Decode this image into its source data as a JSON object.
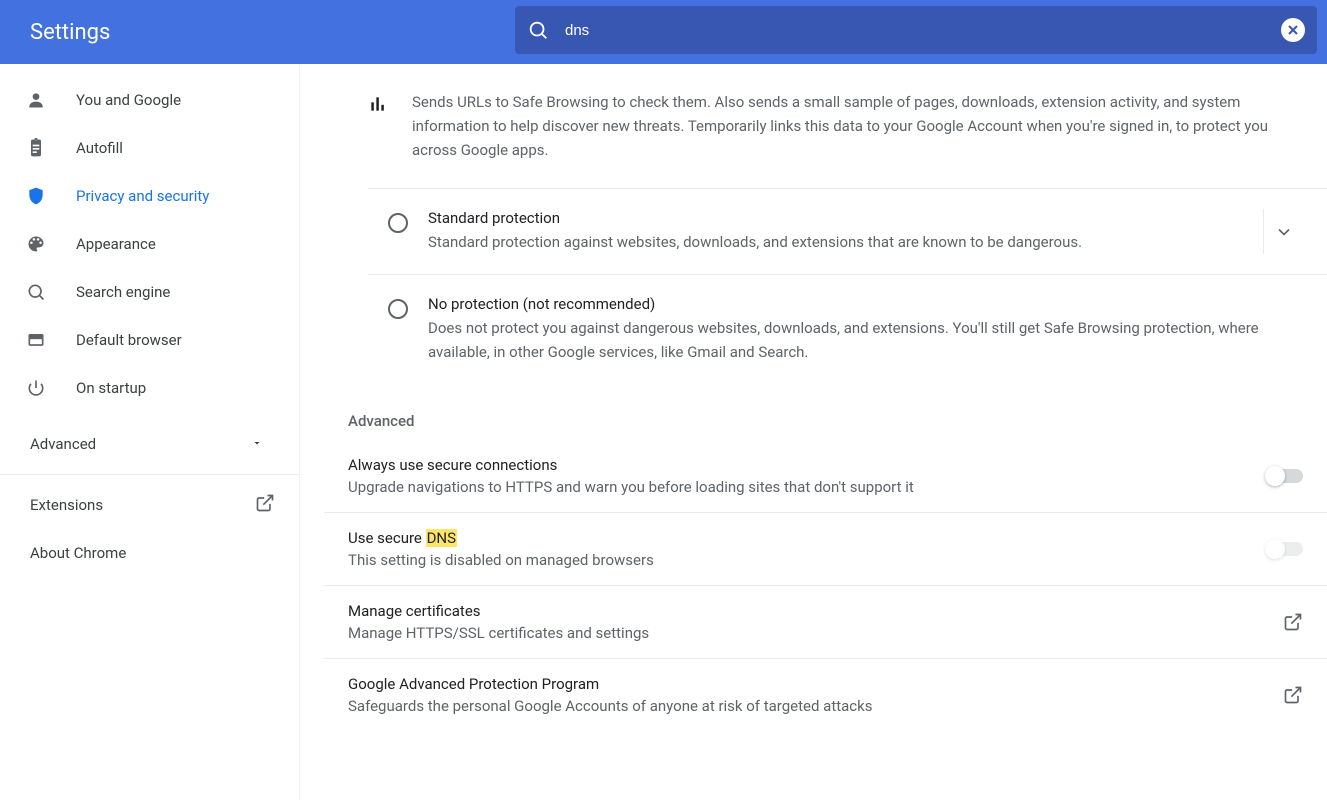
{
  "header": {
    "title": "Settings"
  },
  "search": {
    "value": "dns"
  },
  "sidebar": {
    "items": [
      {
        "label": "You and Google"
      },
      {
        "label": "Autofill"
      },
      {
        "label": "Privacy and security"
      },
      {
        "label": "Appearance"
      },
      {
        "label": "Search engine"
      },
      {
        "label": "Default browser"
      },
      {
        "label": "On startup"
      }
    ],
    "advanced_label": "Advanced",
    "extensions_label": "Extensions",
    "about_label": "About Chrome"
  },
  "main": {
    "enhanced_description": "Sends URLs to Safe Browsing to check them. Also sends a small sample of pages, downloads, extension activity, and system information to help discover new threats. Temporarily links this data to your Google Account when you're signed in, to protect you across Google apps.",
    "options": [
      {
        "title": "Standard protection",
        "subtitle": "Standard protection against websites, downloads, and extensions that are known to be dangerous.",
        "expandable": true
      },
      {
        "title": "No protection (not recommended)",
        "subtitle": "Does not protect you against dangerous websites, downloads, and extensions. You'll still get Safe Browsing protection, where available, in other Google services, like Gmail and Search.",
        "expandable": false
      }
    ],
    "section_label": "Advanced",
    "settings": [
      {
        "title": "Always use secure connections",
        "subtitle": "Upgrade navigations to HTTPS and warn you before loading sites that don't support it",
        "control": "toggle",
        "enabled": true,
        "on": false
      },
      {
        "title_pre": "Use secure ",
        "title_hl": "DNS",
        "subtitle": "This setting is disabled on managed browsers",
        "control": "toggle",
        "enabled": false,
        "on": false
      },
      {
        "title": "Manage certificates",
        "subtitle": "Manage HTTPS/SSL certificates and settings",
        "control": "open"
      },
      {
        "title": "Google Advanced Protection Program",
        "subtitle": "Safeguards the personal Google Accounts of anyone at risk of targeted attacks",
        "control": "open"
      }
    ]
  }
}
